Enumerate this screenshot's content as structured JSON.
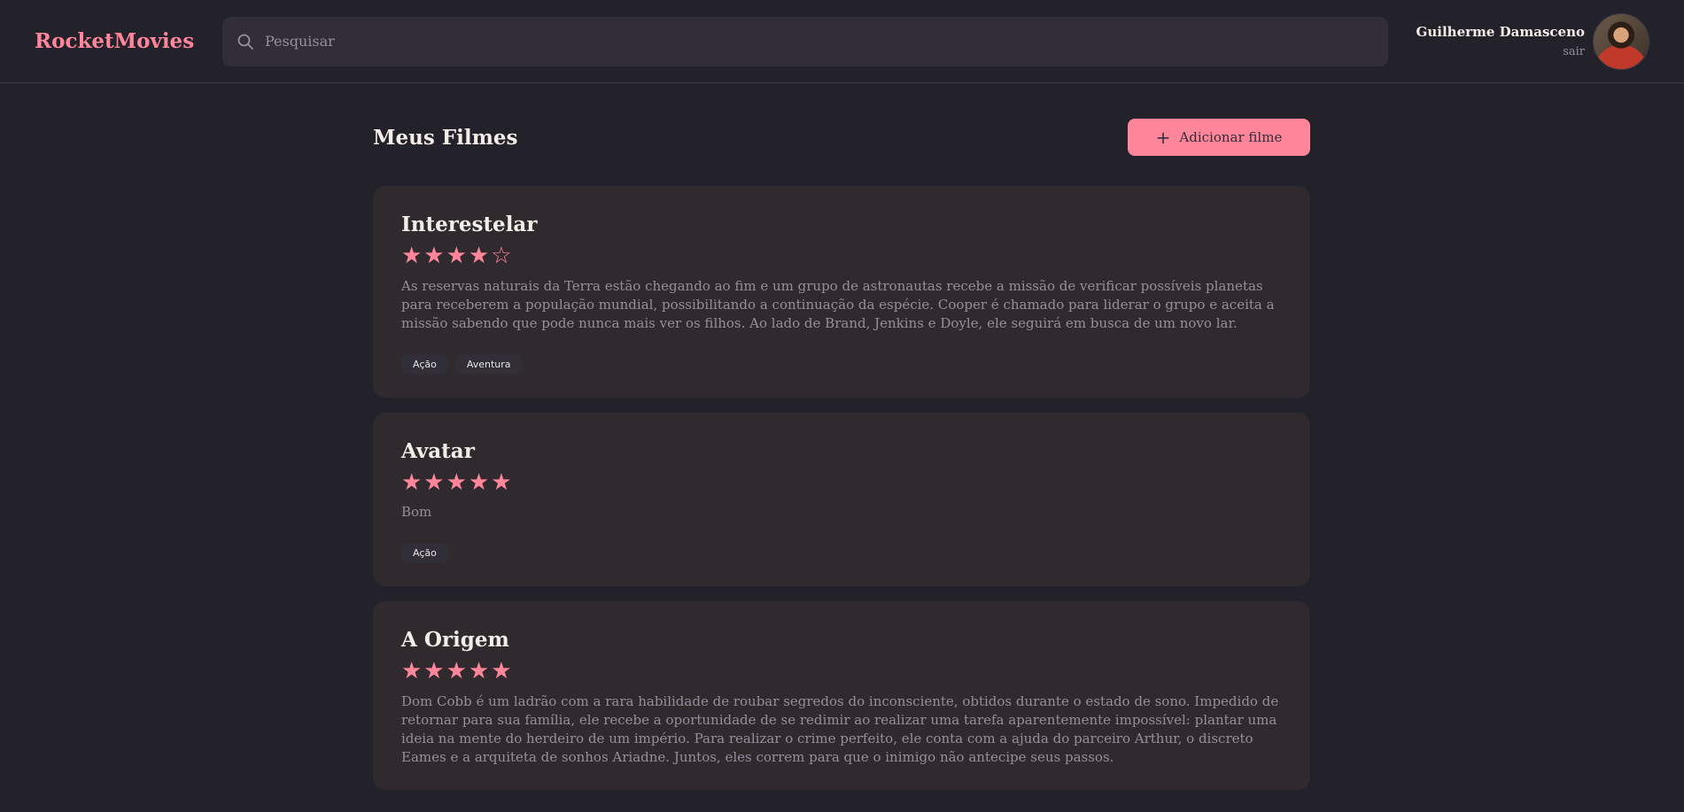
{
  "header": {
    "brand": "RocketMovies",
    "search_placeholder": "Pesquisar",
    "user_name": "Guilherme Damasceno",
    "logout_label": "sair"
  },
  "main": {
    "title": "Meus Filmes",
    "add_button_label": "Adicionar filme",
    "add_button_icon": "plus-icon"
  },
  "movies": [
    {
      "title": "Interestelar",
      "rating": 4,
      "stars": "★★★★☆",
      "description": "As reservas naturais da Terra estão chegando ao fim e um grupo de astronautas recebe a missão de verificar possíveis planetas para receberem a população mundial, possibilitando a continuação da espécie. Cooper é chamado para liderar o grupo e aceita a missão sabendo que pode nunca mais ver os filhos. Ao lado de Brand, Jenkins e Doyle, ele seguirá em busca de um novo lar.",
      "tags": [
        "Ação",
        "Aventura"
      ]
    },
    {
      "title": "Avatar",
      "rating": 5,
      "stars": "★★★★★",
      "description": "Bom",
      "tags": [
        "Ação"
      ]
    },
    {
      "title": "A Origem",
      "rating": 5,
      "stars": "★★★★★",
      "description": "Dom Cobb é um ladrão com a rara habilidade de roubar segredos do inconsciente, obtidos durante o estado de sono. Impedido de retornar para sua família, ele recebe a oportunidade de se redimir ao realizar uma tarefa aparentemente impossível: plantar uma ideia na mente do herdeiro de um império. Para realizar o crime perfeito, ele conta com a ajuda do parceiro Arthur, o discreto Eames e a arquiteta de sonhos Ariadne. Juntos, eles correm para que o inimigo não antecipe seus passos.",
      "tags": []
    }
  ],
  "colors": {
    "accent": "#FF859B",
    "background": "#232129",
    "card": "#302A2F",
    "input": "#312E38",
    "muted_text": "#948F99"
  }
}
